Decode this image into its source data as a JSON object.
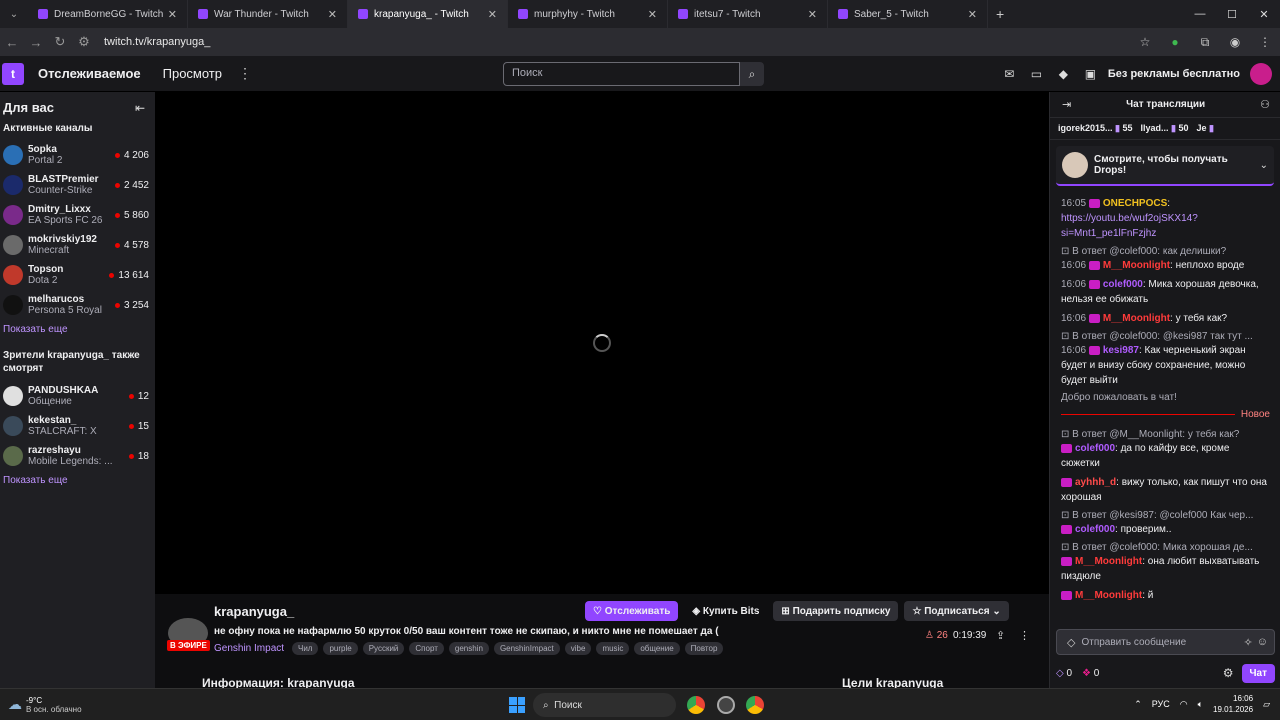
{
  "browser": {
    "tabs": [
      {
        "title": "DreamBorneGG - Twitch",
        "active": false
      },
      {
        "title": "War Thunder - Twitch",
        "active": false
      },
      {
        "title": "krapanyuga_ - Twitch",
        "active": true
      },
      {
        "title": "murphyhy - Twitch",
        "active": false
      },
      {
        "title": "itetsu7 - Twitch",
        "active": false
      },
      {
        "title": "Saber_5 - Twitch",
        "active": false
      }
    ],
    "url": "twitch.tv/krapanyuga_"
  },
  "topnav": {
    "following": "Отслеживаемое",
    "browse": "Просмотр",
    "search_placeholder": "Поиск",
    "ad_free": "Без рекламы бесплатно"
  },
  "sidebar": {
    "title": "Для вас",
    "active_channels_label": "Активные каналы",
    "active_channels": [
      {
        "name": "5opka",
        "game": "Portal 2",
        "viewers": "4 206",
        "color": "#2a6fb5"
      },
      {
        "name": "BLASTPremier",
        "game": "Counter-Strike",
        "viewers": "2 452",
        "color": "#1b2a6b"
      },
      {
        "name": "Dmitry_Lixxx",
        "game": "EA Sports FC 26",
        "viewers": "5 860",
        "color": "#7a2a8a"
      },
      {
        "name": "mokrivskiy192",
        "game": "Minecraft",
        "viewers": "4 578",
        "color": "#6a6a6a"
      },
      {
        "name": "Topson",
        "game": "Dota 2",
        "viewers": "13 614",
        "color": "#c0392b"
      },
      {
        "name": "melharucos",
        "game": "Persona 5 Royal",
        "viewers": "3 254",
        "color": "#111111"
      }
    ],
    "show_more": "Показать еще",
    "also_watch_label": "Зрители krapanyuga_ также смотрят",
    "also_watch": [
      {
        "name": "PANDUSHKAA",
        "game": "Общение",
        "viewers": "12",
        "color": "#e0e0e0"
      },
      {
        "name": "kekestan_",
        "game": "STALCRAFT: X",
        "viewers": "15",
        "color": "#3a4a5a"
      },
      {
        "name": "razreshayu",
        "game": "Mobile Legends: ...",
        "viewers": "18",
        "color": "#5a6a4a"
      }
    ],
    "show_more_2": "Показать еще"
  },
  "stream": {
    "channel": "krapanyuga_",
    "live_label": "В ЭФИРЕ",
    "title": "не офну пока не нафармлю 50 круток 0/50 ваш контент тоже не скипаю, и никто мне не помешает да (",
    "game": "Genshin Impact",
    "tags": [
      "Чил",
      "purple",
      "Русский",
      "Спорт",
      "genshin",
      "GenshinImpact",
      "vibe",
      "music",
      "общение",
      "Повтор"
    ],
    "follow": "Отслеживать",
    "buy_bits": "Купить Bits",
    "gift_sub": "Подарить подписку",
    "subscribe": "Подписаться",
    "viewers": "26",
    "uptime": "0:19:39",
    "about": "Информация: krapanyuga_",
    "goals": "Цели krapanyuga_"
  },
  "chat": {
    "title": "Чат трансляции",
    "gifters": [
      {
        "name": "igorek2015...",
        "count": "55"
      },
      {
        "name": "Ilyad...",
        "count": "50"
      },
      {
        "name": "Je",
        "count": ""
      }
    ],
    "drops": "Смотрите, чтобы получать Drops!",
    "messages": [
      {
        "reply": "",
        "ts": "16:05",
        "user": "ONECHPOCS",
        "user_color": "#f0c020",
        "text": "",
        "link": "https://youtu.be/wuf2ojSKX14?si=Mnt1_pe1lFnFzjhz"
      },
      {
        "reply": "В ответ @colef000: как делишки?",
        "ts": "16:06",
        "user": "M__Moonlight",
        "user_color": "#ff3b3b",
        "text": "неплохо вроде",
        "link": ""
      },
      {
        "reply": "",
        "ts": "16:06",
        "user": "colef000",
        "user_color": "#b05cff",
        "text": "Мика хорошая девочка, нельзя ее обижать",
        "link": ""
      },
      {
        "reply": "",
        "ts": "16:06",
        "user": "M__Moonlight",
        "user_color": "#ff3b3b",
        "text": "у тебя как?",
        "link": ""
      },
      {
        "reply": "В ответ @colef000: @kesi987 так тут ...",
        "ts": "16:06",
        "user": "kesi987",
        "user_color": "#b05cff",
        "text": "Как черненький экран будет и внизу сбоку сохранение, можно будет выйти",
        "link": ""
      }
    ],
    "welcome": "Добро пожаловать в чат!",
    "new_label": "Новое",
    "messages_new": [
      {
        "reply": "В ответ @M__Moonlight: у тебя как?",
        "ts": "",
        "user": "colef000",
        "user_color": "#b05cff",
        "text": "да по кайфу все, кроме сюжетки",
        "link": ""
      },
      {
        "reply": "",
        "ts": "",
        "user": "ayhhh_d",
        "user_color": "#ff4b4b",
        "text": "вижу только, как пишут что она хорошая",
        "link": ""
      },
      {
        "reply": "В ответ @kesi987: @colef000 Как чер...",
        "ts": "",
        "user": "colef000",
        "user_color": "#b05cff",
        "text": "проверим..",
        "link": ""
      },
      {
        "reply": "В ответ @colef000: Мика хорошая де...",
        "ts": "",
        "user": "M__Moonlight",
        "user_color": "#ff3b3b",
        "text": "она любит выхватывать пиздюле",
        "link": ""
      },
      {
        "reply": "",
        "ts": "",
        "user": "M__Moonlight",
        "user_color": "#ff3b3b",
        "text": "й",
        "link": ""
      }
    ],
    "input_placeholder": "Отправить сообщение",
    "points_1": "0",
    "points_2": "0",
    "send": "Чат"
  },
  "taskbar": {
    "temp": "-9°C",
    "weather": "В осн. облачно",
    "search": "Поиск",
    "lang": "РУС",
    "time": "16:06",
    "date": "19.01.2026"
  }
}
